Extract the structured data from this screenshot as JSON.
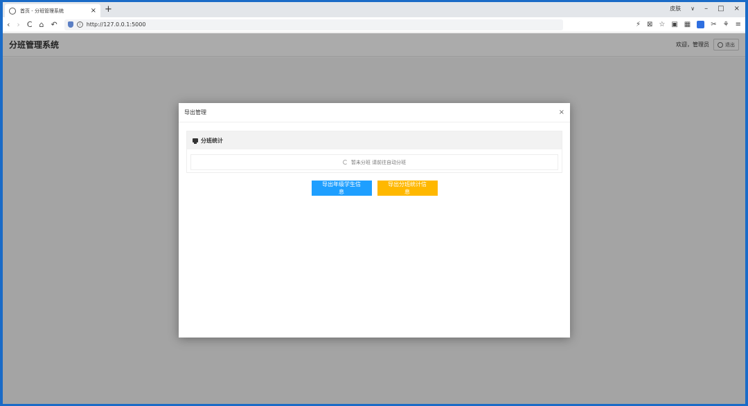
{
  "browser": {
    "tab_title": "首页 - 分班管理系统",
    "tab_close": "×",
    "new_tab": "+",
    "window_controls": {
      "menu_text": "皮肤",
      "chevron": "∨",
      "minimize": "–",
      "maximize": "□",
      "close": "×"
    },
    "nav": {
      "back": "‹",
      "forward": "›",
      "reload": "C",
      "home": "⌂",
      "undo": "↶"
    },
    "url": "http://127.0.0.1:5000",
    "tool_icons": [
      "⚡",
      "⊠",
      "☆",
      "▣",
      "▦",
      "✂",
      "⚘",
      "≡"
    ]
  },
  "app": {
    "title": "分班管理系统",
    "welcome": "欢迎，管理员",
    "logout_label": "退出"
  },
  "modal": {
    "title": "导出管理",
    "close": "×",
    "panel_title": "分班统计",
    "status_text": "暂未分班 请前往自动分班",
    "buttons": {
      "export_students": "导出年级学生信息",
      "export_stats": "导出分班统计信息"
    }
  },
  "colors": {
    "primary_blue": "#1e9fff",
    "warning_orange": "#ffb800",
    "frame_blue": "#1a6bc7"
  }
}
